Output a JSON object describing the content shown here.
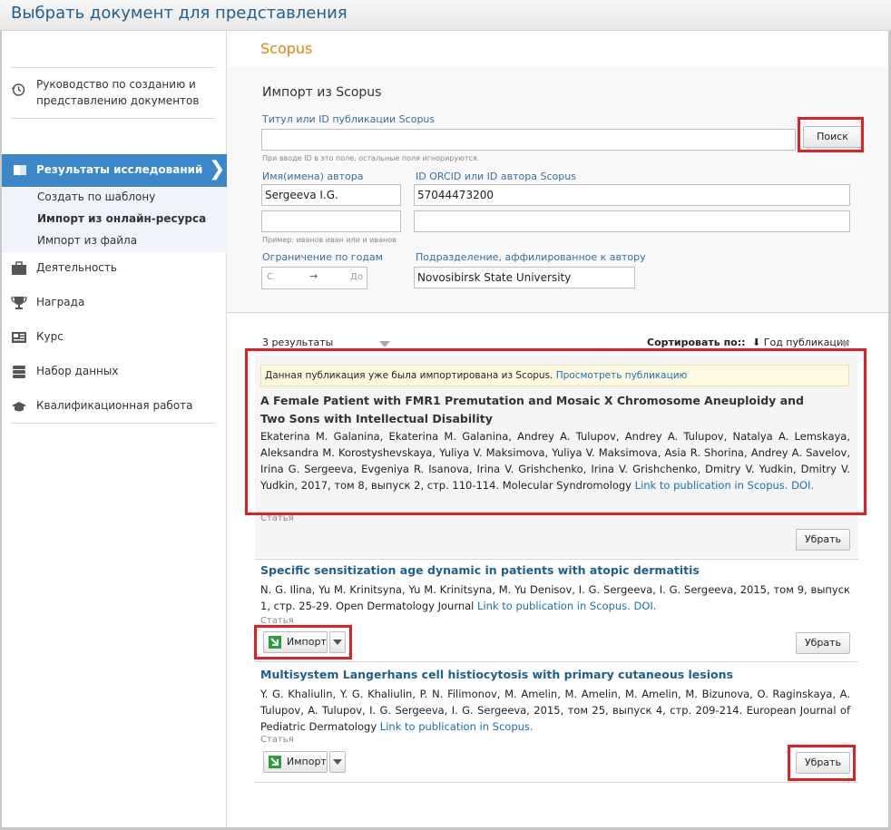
{
  "window": {
    "title": "Выбрать документ для представления"
  },
  "sidebar": {
    "guide": "Руководство по созданию и представлению документов",
    "active": "Результаты исследований",
    "sub_items": [
      "Создать по шаблону",
      "Импорт из онлайн-ресурса",
      "Импорт из файла"
    ],
    "items": [
      "Деятельность",
      "Награда",
      "Курс",
      "Набор данных",
      "Квалификационная работа"
    ]
  },
  "main": {
    "source": "Scopus",
    "form": {
      "heading": "Импорт из Scopus",
      "title_label": "Титул или ID публикации Scopus",
      "title_value": "",
      "title_hint": "При вводе ID в это поле, остальные поля игнорируются.",
      "search_button": "Поиск",
      "author_label": "Имя(имена) автора",
      "author_value": "Sergeeva I.G.",
      "author2_value": "",
      "author_hint": "Пример: иванов иван или и иванов",
      "orcid_label": "ID ORCID или ID автора Scopus",
      "orcid_value": "57044473200",
      "orcid2_value": "",
      "years_label": "Ограничение по годам",
      "year_from": "С",
      "year_arrow": "→",
      "year_to": "До",
      "affil_label": "Подразделение, аффилированное к автору",
      "affil_value": "Novosibirsk State University"
    },
    "results": {
      "count": "3 результаты",
      "sort_label": "Сортировать по::",
      "sort_arrow": "⬇",
      "sort_value": "Год публикации",
      "items": [
        {
          "notice": "Данная публикация уже была импортирована из Scopus.",
          "notice_link": "Просмотреть публикацию",
          "title": "A Female Patient with FMR1 Premutation and Mosaic X Chromosome Aneuploidy and Two Sons with Intellectual Disability",
          "authors": "Ekaterina M. Galanina, Ekaterina M. Galanina, Andrey A. Tulupov, Andrey A. Tulupov, Natalya A. Lemskaya, Aleksandra M. Korostyshevskaya, Yuliya V. Maksimova, Yuliya V. Maksimova, Asia R. Shorina, Andrey A. Savelov, Irina G. Sergeeva, Evgeniya R. Isanova, Irina V. Grishchenko, Irina V. Grishchenko, Dmitry V. Yudkin, Dmitry V. Yudkin, 2017, том 8, выпуск 2, стр. 110-114. Molecular Syndromology",
          "link": "Link to publication in Scopus.",
          "doi": "DOI.",
          "type": "Статья",
          "remove": "Убрать"
        },
        {
          "title": "Specific sensitization age dynamic in patients with atopic dermatitis",
          "authors": "N. G. Ilina, Yu M. Krinitsyna, Yu M. Krinitsyna, M. Yu Denisov, I. G. Sergeeva, I. G. Sergeeva, 2015, том 9, выпуск 1, стр. 25-29. Open Dermatology Journal",
          "link": "Link to publication in Scopus.",
          "doi": "DOI.",
          "type": "Статья",
          "import": "Импорт",
          "remove": "Убрать"
        },
        {
          "title": "Multisystem Langerhans cell histiocytosis with primary cutaneous lesions",
          "authors": "Y. G. Khaliulin, Y. G. Khaliulin, P. N. Filimonov, M. Amelin, M. Amelin, M. Amelin, M. Bizunova, O. Raginskaya, A. Tulupov, A. Tulupov, I. G. Sergeeva, I. G. Sergeeva, 2015, том 25, выпуск 4, стр. 209-214. European Journal of Pediatric Dermatology",
          "link": "Link to publication in Scopus.",
          "type": "Статья",
          "import": "Импорт",
          "remove": "Убрать"
        }
      ]
    }
  },
  "colors": {
    "accent": "#3b87c9",
    "source_title": "#e8810c",
    "highlight": "#e31e24",
    "link": "#1a6fb5"
  },
  "icons": [
    "history-icon",
    "book-icon",
    "chevron-right-icon",
    "briefcase-icon",
    "trophy-icon",
    "course-icon",
    "database-icon",
    "graduation-cap-icon",
    "import-arrow-icon",
    "dropdown-arrow-icon"
  ]
}
